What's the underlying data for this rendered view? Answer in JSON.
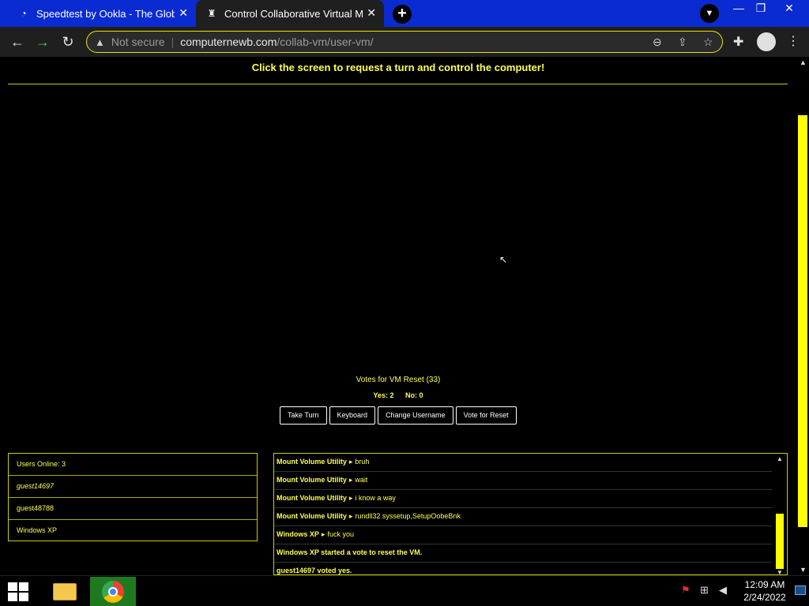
{
  "browser": {
    "tabs": [
      {
        "title": "Speedtest by Ookla - The Global Broadband Speed Test",
        "icon": "speedtest-icon",
        "active": false
      },
      {
        "title": "Control Collaborative Virtual Machine",
        "icon": "collabvm-icon",
        "active": true
      }
    ],
    "address": {
      "security": "Not secure",
      "host": "computernewb.com",
      "path": "/collab-vm/user-vm/"
    }
  },
  "page": {
    "headline": "Click the screen to request a turn and control the computer!",
    "vote": {
      "title": "Votes for VM Reset (33)",
      "yes": "Yes: 2",
      "no": "No: 0"
    },
    "buttons": {
      "take_turn": "Take Turn",
      "keyboard": "Keyboard",
      "change_username": "Change Username",
      "vote_reset": "Vote for Reset"
    },
    "users": {
      "online_label": "Users Online: 3",
      "list": [
        "guest14697",
        "guest48788",
        "Windows XP"
      ]
    },
    "chat": [
      {
        "user": "Mount Volume Utility",
        "message": "bruh"
      },
      {
        "user": "Mount Volume Utility",
        "message": "wait"
      },
      {
        "user": "Mount Volume Utility",
        "message": "i know a way"
      },
      {
        "user": "Mount Volume Utility",
        "message": "rundll32 syssetup,SetupOobeBnk"
      },
      {
        "user": "Windows XP",
        "message": "fuck you"
      },
      {
        "system": "Windows XP started a vote to reset the VM."
      },
      {
        "system": "guest14697 voted yes."
      }
    ]
  },
  "taskbar": {
    "time": "12:09 AM",
    "date": "2/24/2022"
  },
  "colors": {
    "accent": "#ffff00",
    "text": "#ffff50",
    "tabbar": "#0a2bd1"
  }
}
